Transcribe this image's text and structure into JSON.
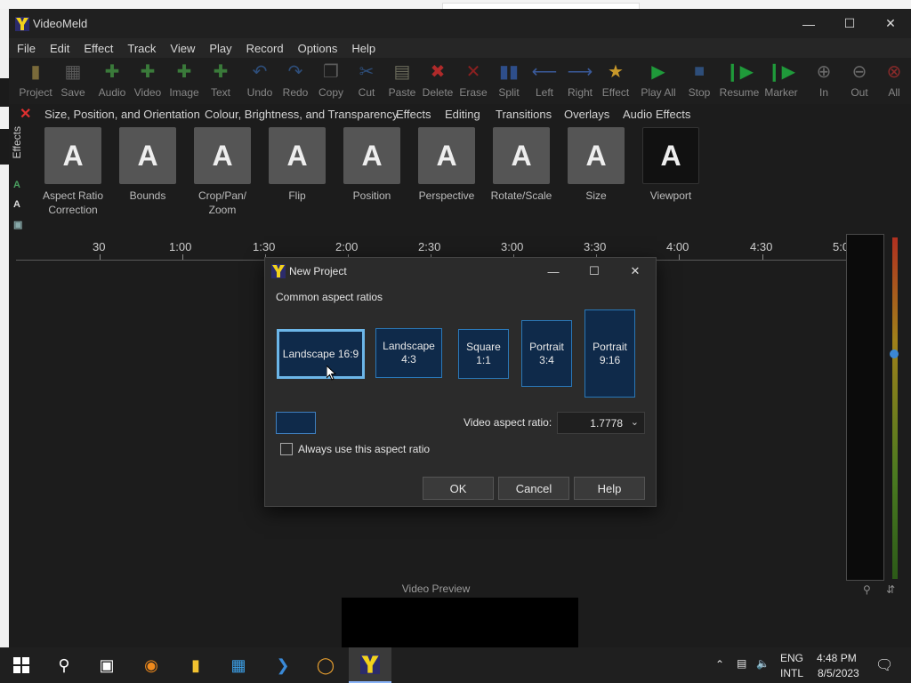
{
  "app": {
    "title": "VideoMeld"
  },
  "menubar": [
    "File",
    "Edit",
    "Effect",
    "Track",
    "View",
    "Play",
    "Record",
    "Options",
    "Help"
  ],
  "toolbar": [
    {
      "label": "Project",
      "icon": "project-icon"
    },
    {
      "label": "Save",
      "icon": "save-icon"
    },
    {
      "label": "Audio",
      "icon": "audio-icon"
    },
    {
      "label": "Video",
      "icon": "video-icon"
    },
    {
      "label": "Image",
      "icon": "image-icon"
    },
    {
      "label": "Text",
      "icon": "text-icon"
    },
    {
      "label": "Undo",
      "icon": "undo-icon"
    },
    {
      "label": "Redo",
      "icon": "redo-icon"
    },
    {
      "label": "Copy",
      "icon": "copy-icon"
    },
    {
      "label": "Cut",
      "icon": "cut-icon"
    },
    {
      "label": "Paste",
      "icon": "paste-icon"
    },
    {
      "label": "Delete",
      "icon": "delete-icon"
    },
    {
      "label": "Erase",
      "icon": "erase-icon"
    },
    {
      "label": "Split",
      "icon": "split-icon"
    },
    {
      "label": "Left",
      "icon": "left-icon"
    },
    {
      "label": "Right",
      "icon": "right-icon"
    },
    {
      "label": "Effect",
      "icon": "star-icon"
    },
    {
      "label": "Play All",
      "icon": "play-icon"
    },
    {
      "label": "Stop",
      "icon": "stop-icon"
    },
    {
      "label": "Resume",
      "icon": "resume-icon"
    },
    {
      "label": "Marker",
      "icon": "marker-icon"
    },
    {
      "label": "In",
      "icon": "zoom-in-icon"
    },
    {
      "label": "Out",
      "icon": "zoom-out-icon"
    },
    {
      "label": "All",
      "icon": "zoom-all-icon"
    }
  ],
  "effects_tabs": [
    "Size, Position, and Orientation",
    "Colour, Brightness, and Transparency",
    "Effects",
    "Editing",
    "Transitions",
    "Overlays",
    "Audio Effects"
  ],
  "effects_side_label": "Effects",
  "effects": [
    {
      "l1": "Aspect Ratio",
      "l2": "Correction",
      "thumb": "A"
    },
    {
      "l1": "Bounds",
      "l2": "",
      "thumb": "A"
    },
    {
      "l1": "Crop/Pan/",
      "l2": "Zoom",
      "thumb": "A"
    },
    {
      "l1": "Flip",
      "l2": "",
      "thumb": "A"
    },
    {
      "l1": "Position",
      "l2": "",
      "thumb": "A"
    },
    {
      "l1": "Perspective",
      "l2": "",
      "thumb": "A"
    },
    {
      "l1": "Rotate/Scale",
      "l2": "",
      "thumb": "A"
    },
    {
      "l1": "Size",
      "l2": "",
      "thumb": "A"
    },
    {
      "l1": "Viewport",
      "l2": "",
      "thumb": "A"
    }
  ],
  "timeline_ticks": [
    "30",
    "1:00",
    "1:30",
    "2:00",
    "2:30",
    "3:00",
    "3:30",
    "4:00",
    "4:30",
    "5:0"
  ],
  "video_preview_label": "Video Preview",
  "dialog": {
    "title": "New Project",
    "subtitle": "Common aspect ratios",
    "ratios": [
      {
        "l1": "Landscape 16:9",
        "l2": ""
      },
      {
        "l1": "Landscape",
        "l2": "4:3"
      },
      {
        "l1": "Square",
        "l2": "1:1"
      },
      {
        "l1": "Portrait",
        "l2": "3:4"
      },
      {
        "l1": "Portrait",
        "l2": "9:16"
      }
    ],
    "selected_ratio": "Landscape 16:9",
    "aspect_label": "Video aspect ratio:",
    "aspect_value": "1.7778",
    "checkbox_label": "Always use this aspect ratio",
    "checkbox_checked": false,
    "ok": "OK",
    "cancel": "Cancel",
    "help": "Help"
  },
  "taskbar": {
    "lang1": "ENG",
    "lang2": "INTL",
    "time": "4:48 PM",
    "date": "8/5/2023"
  },
  "colors": {
    "accent": "#2a78b8",
    "selected_border": "#6cb6e8",
    "button_fill": "#0f2a4a"
  }
}
